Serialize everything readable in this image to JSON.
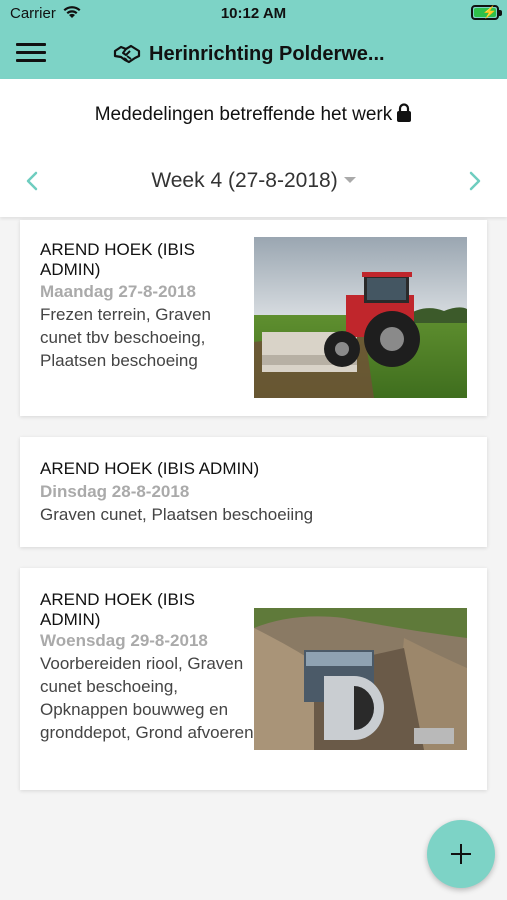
{
  "status_bar": {
    "carrier": "Carrier",
    "time": "10:12 AM",
    "wifi_icon": "wifi-icon",
    "battery_icon": "battery-charging-icon"
  },
  "nav": {
    "title": "Herinrichting Polderwe...",
    "menu_icon": "hamburger-menu-icon",
    "title_icon": "handshake-icon"
  },
  "notice": {
    "text": "Mededelingen betreffende het werk",
    "icon": "lock-icon"
  },
  "week": {
    "label": "Week 4 (27-8-2018)",
    "prev_icon": "chevron-left-icon",
    "next_icon": "chevron-right-icon"
  },
  "entries": [
    {
      "author": "AREND HOEK (IBIS ADMIN)",
      "date": "Maandag 27-8-2018",
      "description": "Frezen terrein, Graven cunet tbv beschoeing, Plaatsen beschoeing",
      "photo": "tractor-in-field-photo"
    },
    {
      "author": "AREND HOEK (IBIS ADMIN)",
      "date": "Dinsdag 28-8-2018",
      "description": "Graven cunet, Plaatsen beschoeiing"
    },
    {
      "author": "AREND HOEK (IBIS ADMIN)",
      "date": "Woensdag 29-8-2018",
      "description": "Voorbereiden riool, Graven cunet beschoeing, Opknappen bouwweg en gronddepot, Grond afvoeren",
      "photo": "sewer-pipe-trench-photo"
    }
  ],
  "fab": {
    "icon": "plus-icon"
  },
  "colors": {
    "accent": "#7dd3c6",
    "date_text": "#aaaaaa",
    "chevron": "#6ecdbf"
  }
}
